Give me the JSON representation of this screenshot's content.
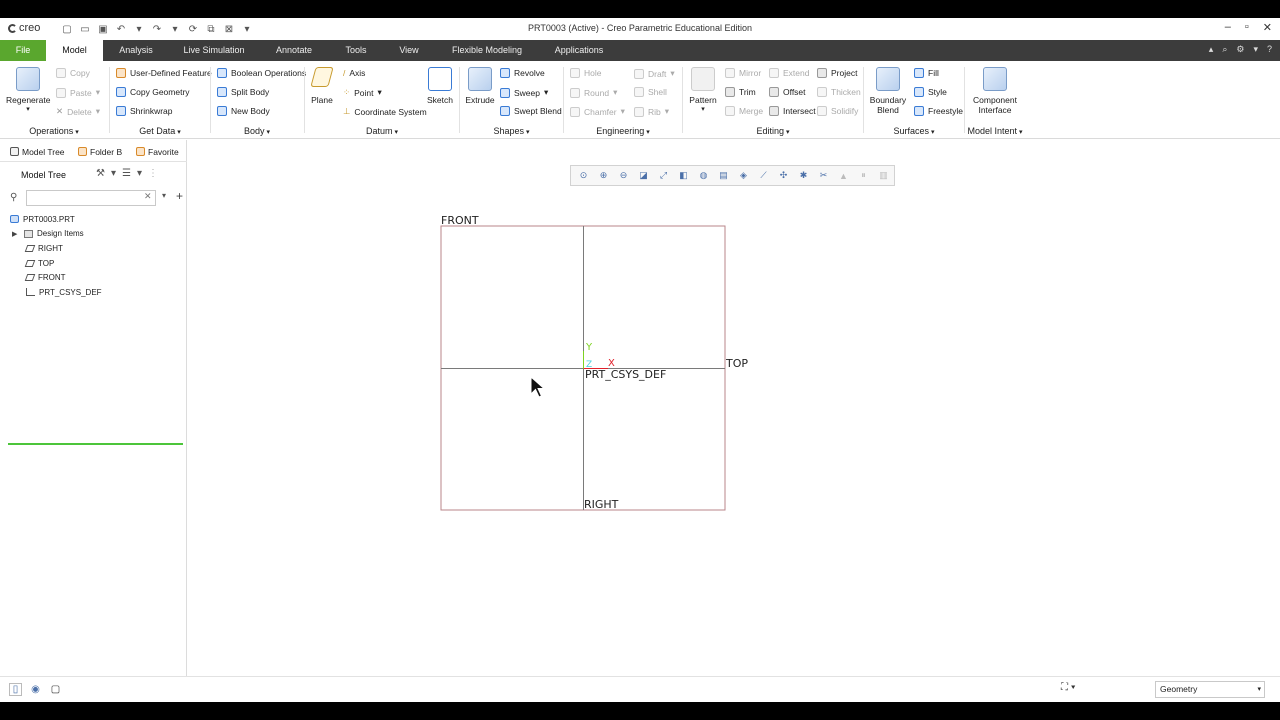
{
  "app": {
    "logo_text": "creo",
    "window_title": "PRT0003 (Active) - Creo Parametric Educational Edition"
  },
  "colors": {
    "tab_bar": "#3c3c3c",
    "file_tab": "#5aa72e",
    "plane_outline": "#b8868a",
    "axis_x": "#e0202a",
    "axis_y": "#7ed321",
    "axis_z": "#4ad0e0",
    "tree_highlight": "#4cc53a"
  },
  "tabs": [
    {
      "label": "File"
    },
    {
      "label": "Model"
    },
    {
      "label": "Analysis"
    },
    {
      "label": "Live Simulation"
    },
    {
      "label": "Annotate"
    },
    {
      "label": "Tools"
    },
    {
      "label": "View"
    },
    {
      "label": "Flexible Modeling"
    },
    {
      "label": "Applications"
    }
  ],
  "ribbon": {
    "operations": {
      "label": "Operations",
      "regenerate": "Regenerate",
      "copy": "Copy",
      "paste": "Paste",
      "delete": "Delete"
    },
    "get_data": {
      "label": "Get Data",
      "udf": "User-Defined Feature",
      "copy_geometry": "Copy Geometry",
      "shrinkwrap": "Shrinkwrap"
    },
    "body": {
      "label": "Body",
      "boolean": "Boolean Operations",
      "split": "Split Body",
      "new": "New Body"
    },
    "datum": {
      "label": "Datum",
      "plane": "Plane",
      "axis": "Axis",
      "point": "Point",
      "csys": "Coordinate System",
      "sketch": "Sketch"
    },
    "shapes": {
      "label": "Shapes",
      "extrude": "Extrude",
      "revolve": "Revolve",
      "sweep": "Sweep",
      "swept_blend": "Swept Blend"
    },
    "engineering": {
      "label": "Engineering",
      "hole": "Hole",
      "draft": "Draft",
      "round": "Round",
      "shell": "Shell",
      "chamfer": "Chamfer",
      "rib": "Rib"
    },
    "editing": {
      "label": "Editing",
      "pattern": "Pattern",
      "mirror": "Mirror",
      "extend": "Extend",
      "project": "Project",
      "trim": "Trim",
      "offset": "Offset",
      "thicken": "Thicken",
      "merge": "Merge",
      "intersect": "Intersect",
      "solidify": "Solidify"
    },
    "surfaces": {
      "label": "Surfaces",
      "boundary_blend_1": "Boundary",
      "boundary_blend_2": "Blend",
      "fill": "Fill",
      "style": "Style",
      "freestyle": "Freestyle"
    },
    "model_intent": {
      "label": "Model Intent",
      "component_1": "Component",
      "component_2": "Interface"
    }
  },
  "left_panel": {
    "tabs": [
      {
        "label": "Model Tree"
      },
      {
        "label": "Folder B"
      },
      {
        "label": "Favorite"
      }
    ],
    "title": "Model Tree",
    "search": {
      "value": "",
      "placeholder": ""
    },
    "tree": [
      {
        "label": "PRT0003.PRT",
        "icon": "part-icon"
      },
      {
        "label": "Design Items",
        "icon": "folder-icon"
      },
      {
        "label": "RIGHT",
        "icon": "datum-plane-icon"
      },
      {
        "label": "TOP",
        "icon": "datum-plane-icon"
      },
      {
        "label": "FRONT",
        "icon": "datum-plane-icon"
      },
      {
        "label": "PRT_CSYS_DEF",
        "icon": "csys-icon"
      }
    ]
  },
  "viewport": {
    "labels": {
      "front": "FRONT",
      "top": "TOP",
      "right": "RIGHT",
      "csys": "PRT_CSYS_DEF",
      "x": "X",
      "y": "Y",
      "z": "Z"
    }
  },
  "status": {
    "filter_value": "Geometry"
  }
}
